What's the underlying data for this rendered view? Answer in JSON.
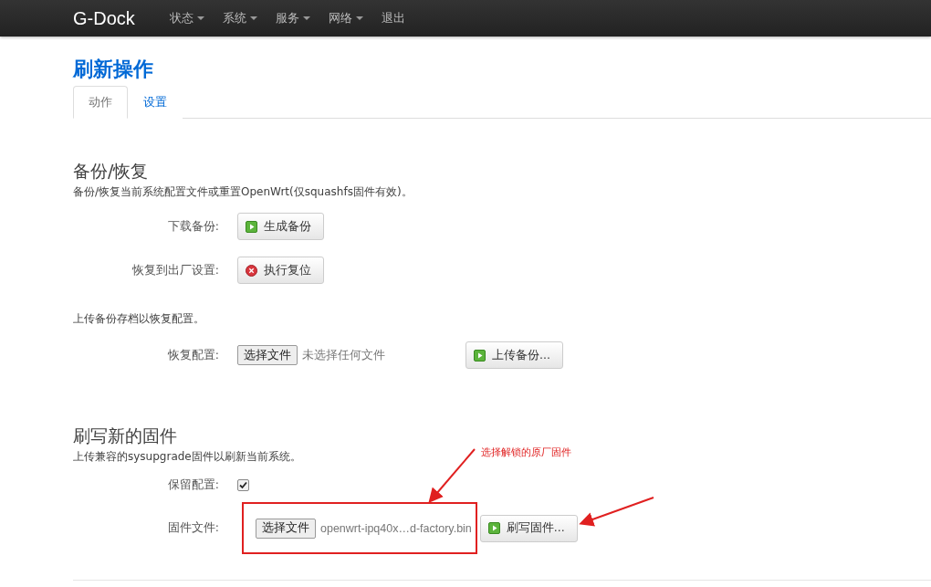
{
  "navbar": {
    "brand": "G-Dock",
    "menu": [
      {
        "label": "状态",
        "dropdown": true
      },
      {
        "label": "系统",
        "dropdown": true
      },
      {
        "label": "服务",
        "dropdown": true
      },
      {
        "label": "网络",
        "dropdown": true
      },
      {
        "label": "退出",
        "dropdown": false
      }
    ]
  },
  "page_title": "刷新操作",
  "tabs": [
    {
      "label": "动作",
      "selected": true
    },
    {
      "label": "设置",
      "selected": false
    }
  ],
  "sections": [
    {
      "title": "备份/恢复",
      "description": "备份/恢复当前系统配置文件或重置OpenWrt(仅squashfs固件有效)。",
      "rows": [
        {
          "kind": "button",
          "label": "下载备份:",
          "button": {
            "label": "生成备份",
            "kind": "run"
          }
        },
        {
          "kind": "button",
          "label": "恢复到出厂设置:",
          "button": {
            "label": "执行复位",
            "kind": "reset"
          }
        },
        {
          "kind": "note",
          "text": "上传备份存档以恢复配置。"
        },
        {
          "kind": "file",
          "label": "恢复配置:",
          "choose": "选择文件",
          "file_status": "未选择任何文件",
          "highlighted": false,
          "button": {
            "label": "上传备份...",
            "kind": "run"
          }
        }
      ]
    },
    {
      "title": "刷写新的固件",
      "description": "上传兼容的sysupgrade固件以刷新当前系统。",
      "rows": [
        {
          "kind": "checkbox",
          "label": "保留配置:",
          "checked": true
        },
        {
          "kind": "file",
          "label": "固件文件:",
          "choose": "选择文件",
          "file_status": "openwrt-ipq40x…d-factory.bin",
          "highlighted": true,
          "button": {
            "label": "刷写固件...",
            "kind": "run"
          }
        }
      ]
    }
  ],
  "annotation": {
    "text": "选择解锁的原厂固件"
  }
}
